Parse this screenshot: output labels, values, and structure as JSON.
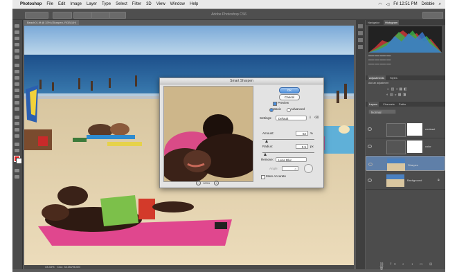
{
  "menubar": {
    "apple": "",
    "items": [
      "Photoshop",
      "File",
      "Edit",
      "Image",
      "Layer",
      "Type",
      "Select",
      "Filter",
      "3D",
      "View",
      "Window",
      "Help"
    ],
    "clock": "Fri 12:51 PM",
    "user": "Debbie"
  },
  "app_title": "Adobe Photoshop CS6",
  "doc_tab": "Beach01.tif @ 33% (Sharpen, RGB/16*)",
  "status": {
    "zoom": "33.33%",
    "doc": "Doc: 34.3M/96.0M"
  },
  "dialog": {
    "title": "Smart Sharpen",
    "ok": "OK",
    "cancel": "Cancel",
    "preview_label": "Preview",
    "basic_label": "Basic",
    "advanced_label": "Advanced",
    "settings_label": "Settings:",
    "settings_value": "Default",
    "amount_label": "Amount:",
    "amount_value": "62",
    "amount_unit": "%",
    "amount_level": 0.08,
    "radius_label": "Radius:",
    "radius_value": "0.5",
    "radius_unit": "px",
    "radius_level": 0.05,
    "remove_label": "Remove:",
    "remove_value": "Lens Blur",
    "angle_label": "Angle:",
    "angle_value": "0",
    "more_accurate_label": "More Accurate",
    "zoom_value": "100%"
  },
  "panels": {
    "histogram_tabs": [
      "Navigator",
      "Histogram"
    ],
    "adjust_tabs": [
      "Adjustments",
      "Styles"
    ],
    "adjust_title": "Add an adjustment",
    "layers_tabs": [
      "Layers",
      "Channels",
      "Paths"
    ],
    "blend_mode": "Normal",
    "layers": [
      {
        "name": "contrast",
        "selected": false,
        "thumb": "mask"
      },
      {
        "name": "color",
        "selected": false,
        "thumb": "mask"
      },
      {
        "name": "Sharpen",
        "selected": true,
        "thumb": "photo"
      },
      {
        "name": "Background",
        "selected": false,
        "thumb": "photo"
      }
    ]
  }
}
